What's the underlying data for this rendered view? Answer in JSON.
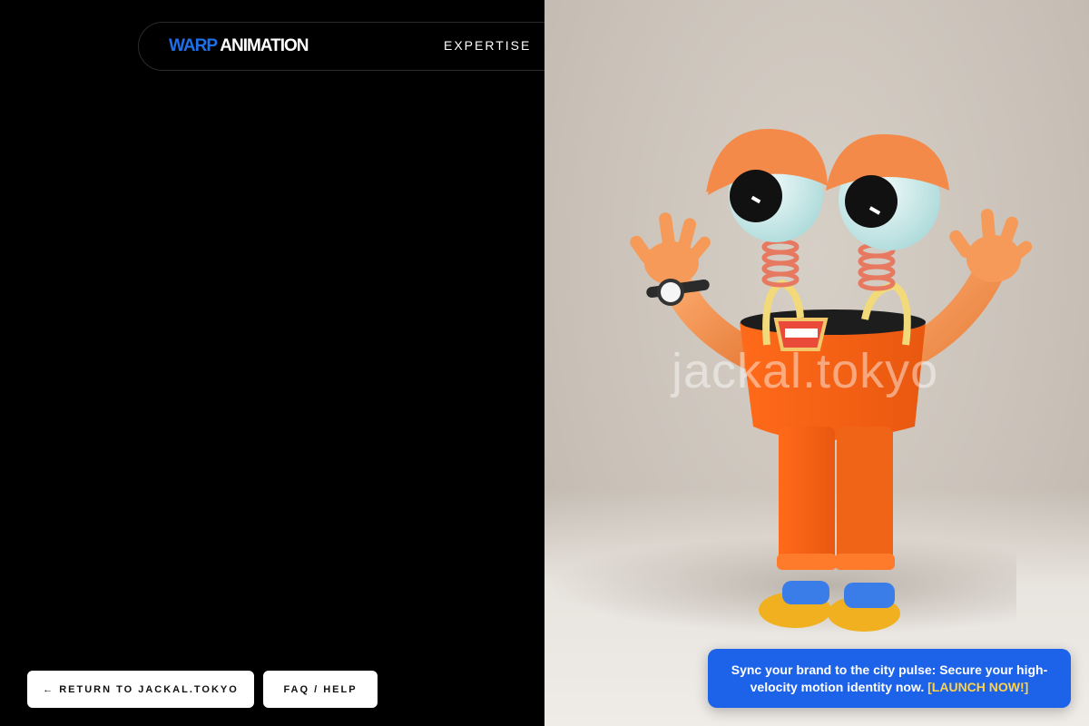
{
  "brand": {
    "part1": "WARP",
    "part2": " ANIMATION",
    "accent_color": "#1f6fe8"
  },
  "nav": {
    "items": [
      {
        "label": "EXPERTISE"
      }
    ]
  },
  "hero": {
    "watermark": "jackal.tokyo",
    "image": "orange-cartoon-character-with-spring-eyes"
  },
  "buttons": {
    "return_label": "← RETURN TO JACKAL.TOKYO",
    "faq_label": "FAQ / HELP"
  },
  "promo": {
    "text": "Sync your brand to the city pulse: Secure your high-velocity motion identity now.",
    "cta": "[LAUNCH NOW!]",
    "bg_color": "#1d63ea",
    "cta_color": "#ffd24a"
  }
}
